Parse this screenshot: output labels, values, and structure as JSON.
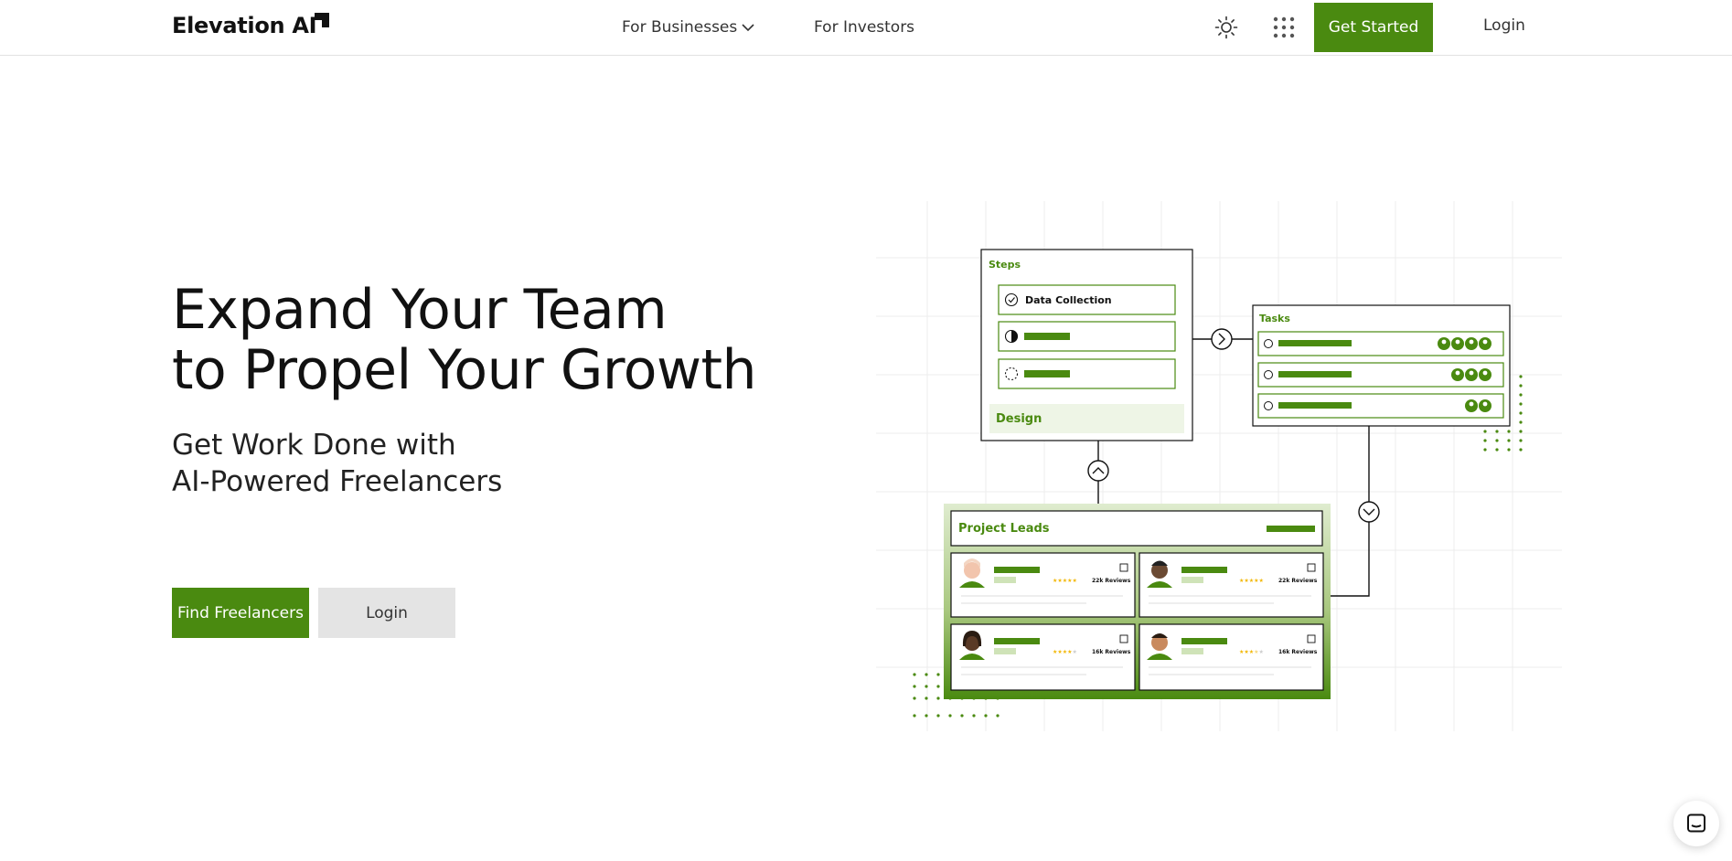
{
  "header": {
    "logo_text": "Elevation AI",
    "nav": {
      "businesses_label": "For Businesses",
      "investors_label": "For Investors"
    },
    "get_started_label": "Get Started",
    "login_label": "Login"
  },
  "hero": {
    "title_line1": "Expand Your Team",
    "title_line2": "to Propel Your Growth",
    "subtitle_line1": "Get Work Done with",
    "subtitle_line2": "AI-Powered Freelancers",
    "find_label": "Find Freelancers",
    "login_label": "Login"
  },
  "illustration": {
    "steps": {
      "title": "Steps",
      "first_step": "Data Collection",
      "footer": "Design"
    },
    "tasks": {
      "title": "Tasks"
    },
    "project_leads": {
      "title": "Project Leads",
      "cards": [
        {
          "reviews": "22k Reviews",
          "stars": 5
        },
        {
          "reviews": "22k Reviews",
          "stars": 5
        },
        {
          "reviews": "16k Reviews",
          "stars": 4
        },
        {
          "reviews": "16k Reviews",
          "stars": 3.5
        }
      ]
    }
  },
  "colors": {
    "brand_green": "#4a8a10",
    "light_green": "#eef5e6",
    "star_yellow": "#f2b705"
  },
  "icons": {
    "logo": "logo-mark-icon",
    "dropdown": "chevron-down-icon",
    "theme": "sun-icon",
    "apps": "apps-grid-icon",
    "chat": "chat-icon"
  }
}
